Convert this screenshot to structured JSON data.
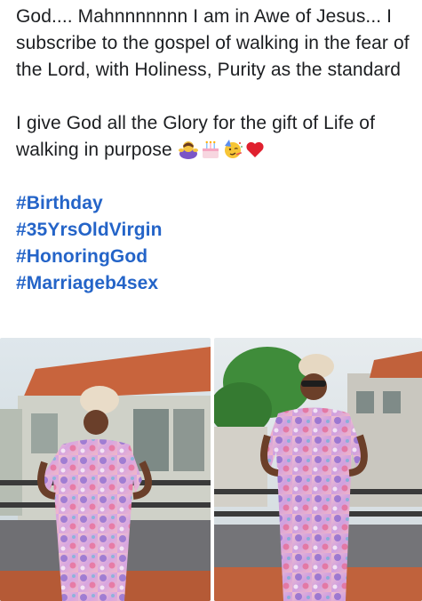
{
  "post": {
    "paragraph_1": "God.... Mahnnnnnnn I am in Awe of Jesus... I subscribe to the gospel of walking in the fear of the Lord, with Holiness, Purity as the standard",
    "paragraph_2": "I give God all the Glory for the gift of Life of walking in purpose",
    "emojis": [
      "woman-bowing-icon",
      "birthday-cake-icon",
      "partying-face-icon",
      "red-heart-icon"
    ],
    "hashtags": [
      "#Birthday",
      "#35YrsOldVirgin",
      "#HonoringGod",
      "#Marriageb4sex"
    ],
    "colors": {
      "text": "#1c1e21",
      "hashtag": "#2464c8",
      "background": "#ffffff"
    }
  },
  "photos": [
    {
      "name": "photo-woman-floral-dress-left"
    },
    {
      "name": "photo-woman-floral-dress-right"
    }
  ]
}
